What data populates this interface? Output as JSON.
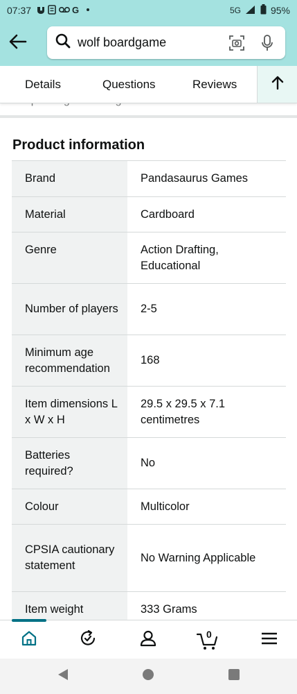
{
  "status_bar": {
    "time": "07:37",
    "network": "5G",
    "battery": "95%"
  },
  "search": {
    "query": "wolf boardgame"
  },
  "tabs": [
    {
      "label": "Details"
    },
    {
      "label": "Questions"
    },
    {
      "label": "Reviews"
    }
  ],
  "cut_off_text": "the pack again and again",
  "product_info": {
    "title": "Product information",
    "rows": [
      {
        "key": "Brand",
        "value": "Pandasaurus Games"
      },
      {
        "key": "Material",
        "value": "Cardboard"
      },
      {
        "key": "Genre",
        "value": "Action Drafting, Educational"
      },
      {
        "key": "Number of players",
        "value": "2-5"
      },
      {
        "key": "Minimum age recommendation",
        "value": "168"
      },
      {
        "key": "Item dimensions L x W x H",
        "value": "29.5 x 29.5 x 7.1 centimetres"
      },
      {
        "key": "Batteries required?",
        "value": "No"
      },
      {
        "key": "Colour",
        "value": "Multicolor"
      },
      {
        "key": "CPSIA cautionary statement",
        "value": "No Warning Applicable"
      },
      {
        "key": "Item weight",
        "value": "333 Grams"
      }
    ]
  },
  "bottom_nav": {
    "cart_count": "0",
    "items": [
      {
        "icon": "home-icon",
        "active": true
      },
      {
        "icon": "buy-again-icon",
        "active": false
      },
      {
        "icon": "account-icon",
        "active": false
      },
      {
        "icon": "cart-icon",
        "active": false
      },
      {
        "icon": "menu-icon",
        "active": false
      }
    ]
  },
  "colors": {
    "header_bg": "#a4e2e0",
    "active_teal": "#007185",
    "key_cell_bg": "#f0f2f2"
  }
}
